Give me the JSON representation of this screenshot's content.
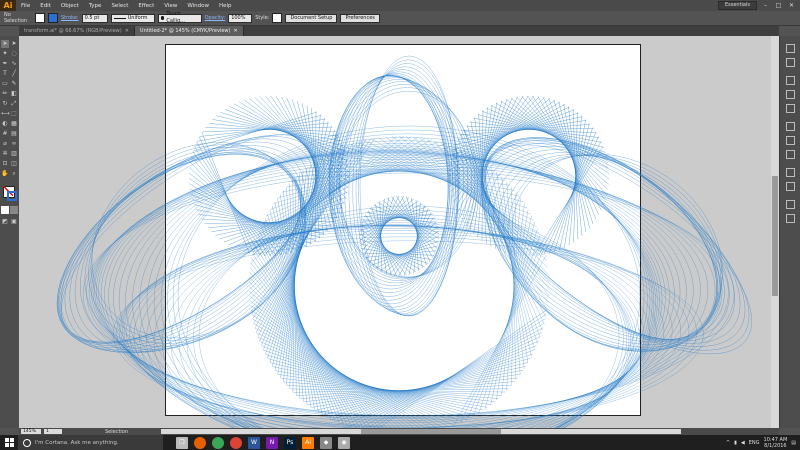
{
  "app": {
    "logo": "Ai"
  },
  "menu": [
    "File",
    "Edit",
    "Object",
    "Type",
    "Select",
    "Effect",
    "View",
    "Window",
    "Help"
  ],
  "workspace": "Essentials",
  "window_controls": {
    "minimize": "–",
    "maximize": "□",
    "close": "✕"
  },
  "control_bar": {
    "selection": "No Selection",
    "stroke_label": "Stroke:",
    "stroke_value": "0.5 pt",
    "uniform_label": "Uniform",
    "brush_label": "Touch Callig...",
    "opacity_label": "Opacity:",
    "opacity_value": "100%",
    "style_label": "Style:",
    "doc_setup": "Document Setup",
    "preferences": "Preferences"
  },
  "tabs": [
    {
      "label": "transform.ai* @ 66.67% (RGB/Preview)",
      "active": false
    },
    {
      "label": "Untitled-2* @ 145% (CMYK/Preview)",
      "active": true
    }
  ],
  "status": {
    "zoom": "145%",
    "page": "1",
    "tool": "Selection"
  },
  "taskbar": {
    "search_placeholder": "I'm Cortana. Ask me anything.",
    "apps": [
      {
        "name": "task-view",
        "glyph": "❐",
        "color": "#bbbbbb"
      },
      {
        "name": "firefox",
        "glyph": "●",
        "color": "#e66000"
      },
      {
        "name": "chrome",
        "glyph": "●",
        "color": "#3aa757"
      },
      {
        "name": "chrome-2",
        "glyph": "●",
        "color": "#db4437"
      },
      {
        "name": "word",
        "glyph": "W",
        "color": "#2b579a"
      },
      {
        "name": "onenote",
        "glyph": "N",
        "color": "#7719aa"
      },
      {
        "name": "photoshop",
        "glyph": "Ps",
        "color": "#001e36"
      },
      {
        "name": "illustrator",
        "glyph": "Ai",
        "color": "#ff7c00"
      },
      {
        "name": "app-8",
        "glyph": "◆",
        "color": "#888888"
      },
      {
        "name": "app-9",
        "glyph": "◉",
        "color": "#aaaaaa"
      }
    ],
    "language": "ENG",
    "time": "10:47 AM",
    "date": "8/1/2016"
  },
  "artwork": {
    "color": "#1f78c8"
  }
}
